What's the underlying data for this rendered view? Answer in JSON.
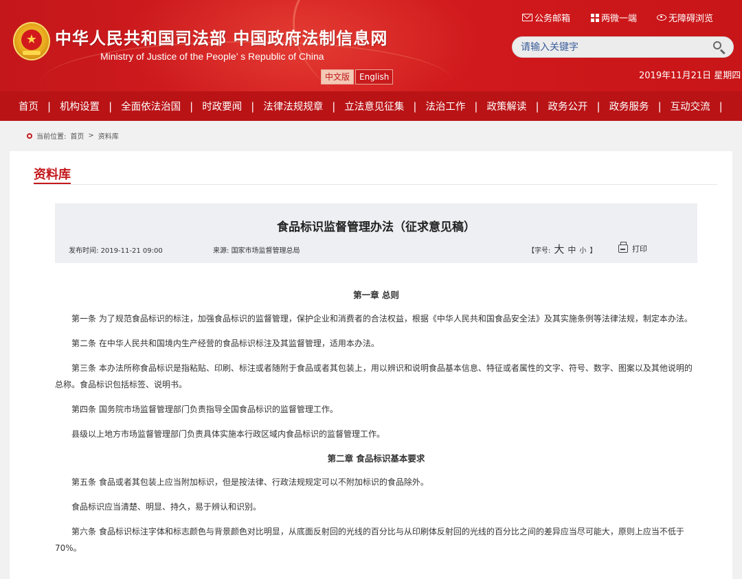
{
  "header": {
    "title": "中华人民共和国司法部  中国政府法制信息网",
    "subtitle": "Ministry of Justice of the People’ s Republic of China",
    "lang_cn": "中文版",
    "lang_en": "English",
    "links": {
      "mail": "公务邮箱",
      "wechat": "两微一端",
      "accessible": "无障碍浏览"
    },
    "search_placeholder": "请输入关键字",
    "date": "2019年11月21日 星期四"
  },
  "nav": {
    "items": [
      "首页",
      "机构设置",
      "全面依法治国",
      "时政要闻",
      "法律法规规章",
      "立法意见征集",
      "法治工作",
      "政策解读",
      "政务公开",
      "政务服务",
      "互动交流"
    ]
  },
  "breadcrumb": {
    "prefix": "当前位置:",
    "home": "首页",
    "sep": ">",
    "current": "资料库"
  },
  "section": {
    "title": "资料库"
  },
  "article": {
    "title": "食品标识监督管理办法（征求意见稿）",
    "publish_label": "发布时间:",
    "publish_time": "2019-11-21 09:00",
    "source_label": "来源:",
    "source": "国家市场监督管理总局",
    "fontsize_open": "【字号:",
    "fontsize_big": "大",
    "fontsize_mid": "中",
    "fontsize_small": "小",
    "fontsize_close": "】",
    "print": "打印",
    "chapter1": "第一章 总则",
    "p1": "第一条 为了规范食品标识的标注，加强食品标识的监督管理，保护企业和消费者的合法权益，根据《中华人民共和国食品安全法》及其实施条例等法律法规，制定本办法。",
    "p2": "第二条 在中华人民共和国境内生产经营的食品标识标注及其监督管理，适用本办法。",
    "p3": "第三条 本办法所称食品标识是指粘贴、印刷、标注或者随附于食品或者其包装上，用以辨识和说明食品基本信息、特征或者属性的文字、符号、数字、图案以及其他说明的总称。食品标识包括标签、说明书。",
    "p4": "第四条 国务院市场监督管理部门负责指导全国食品标识的监督管理工作。",
    "p5": "县级以上地方市场监督管理部门负责具体实施本行政区域内食品标识的监督管理工作。",
    "chapter2": "第二章 食品标识基本要求",
    "p6": "第五条 食品或者其包装上应当附加标识，但是按法律、行政法规规定可以不附加标识的食品除外。",
    "p7": "食品标识应当清楚、明显、持久，易于辨认和识别。",
    "p8": "第六条 食品标识标注字体和标志颜色与背景颜色对比明显，从底面反射回的光线的百分比与从印刷体反射回的光线的百分比之间的差异应当尽可能大，原则上应当不低于70%。"
  },
  "colors": {
    "brand_red": "#c4171b",
    "nav_red": "#b91316",
    "meta_bg": "#eeeff3"
  }
}
